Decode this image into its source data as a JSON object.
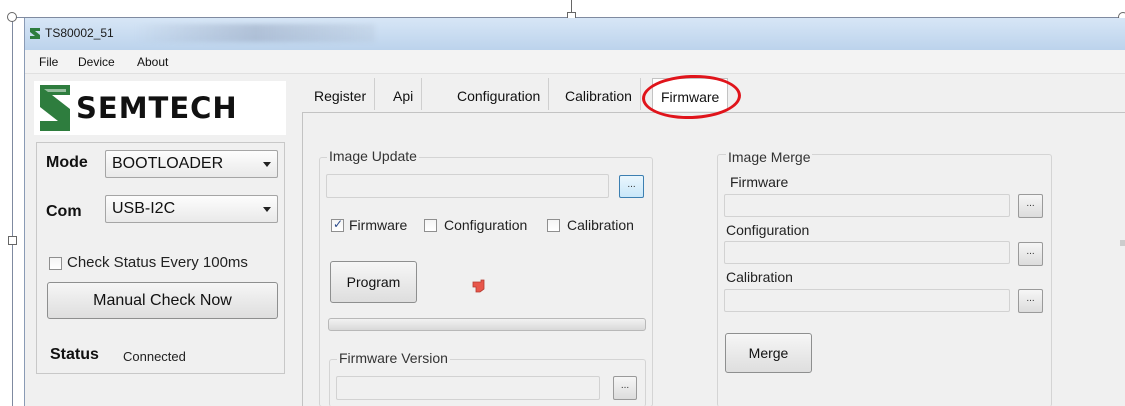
{
  "window": {
    "title": "TS80002_51"
  },
  "menu": {
    "items": [
      "File",
      "Device",
      "About"
    ]
  },
  "logo": {
    "text": "SEMTECH"
  },
  "left_panel": {
    "mode_label": "Mode",
    "mode_value": "BOOTLOADER",
    "com_label": "Com",
    "com_value": "USB-I2C",
    "check_status_label": "Check Status Every 100ms",
    "check_status_checked": false,
    "manual_check_label": "Manual Check Now",
    "status_label": "Status",
    "status_value": "Connected"
  },
  "tabs": [
    {
      "label": "Register",
      "active": false
    },
    {
      "label": "Api",
      "active": false
    },
    {
      "label": "Configuration",
      "active": false
    },
    {
      "label": "Calibration",
      "active": false
    },
    {
      "label": "Firmware",
      "active": true
    }
  ],
  "image_update": {
    "title": "Image Update",
    "path_value": "",
    "browse_label": "...",
    "checks": [
      {
        "label": "Firmware",
        "checked": true
      },
      {
        "label": "Configuration",
        "checked": false
      },
      {
        "label": "Calibration",
        "checked": false
      }
    ],
    "program_label": "Program",
    "progress_fraction": 0
  },
  "firmware_version": {
    "title": "Firmware Version",
    "value": "",
    "browse_label": "..."
  },
  "image_merge": {
    "title": "Image Merge",
    "firmware_label": "Firmware",
    "configuration_label": "Configuration",
    "calibration_label": "Calibration",
    "browse_label": "...",
    "merge_label": "Merge"
  },
  "colors": {
    "highlight_ring": "#e0141b",
    "titlebar": "#c9dcf1",
    "logo_green": "#2e7d3e"
  }
}
